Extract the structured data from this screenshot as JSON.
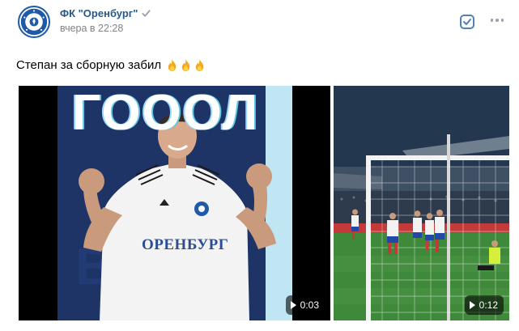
{
  "post": {
    "author": "ФК \"Оренбург\"",
    "time": "вчера в 22:28",
    "text": "Степан за сборную забил"
  },
  "icons": {
    "avatar": "club-logo-icon",
    "verified": "verified-check-icon",
    "checkbox": "checkbox-icon",
    "more": "more-dots-icon",
    "fire": "fire-emoji-icon",
    "play": "play-icon"
  },
  "videos": [
    {
      "overlay_text": "ГОООЛ",
      "jersey_text": "ОРЕНБУРГ",
      "duration": "0:03"
    },
    {
      "duration": "0:12"
    }
  ],
  "colors": {
    "link": "#2a5885",
    "meta": "#828282",
    "accent_icon": "#5181b8",
    "muted_icon": "#99a2ad"
  }
}
